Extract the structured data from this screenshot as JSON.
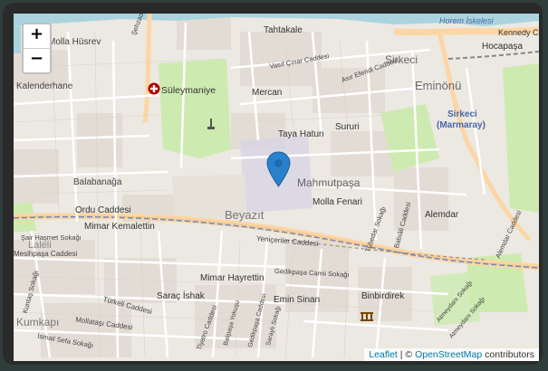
{
  "map": {
    "zoom_in_label": "+",
    "zoom_out_label": "−",
    "attribution": {
      "leaflet": "Leaflet",
      "separator": " | © ",
      "osm": "OpenStreetMap",
      "contributors": " contributors"
    },
    "place_labels": {
      "horem_iskelesi": "Horem İskelesi",
      "tahtakale": "Tahtakale",
      "kennedy": "Kennedy C",
      "molla_husrev": "Molla Hüsrev",
      "sehzade": "Şehzadebaşı Caddesi",
      "vasif_cinar": "Vasıf Çınar Caddesi",
      "asir_efendi": "Asır Efendi Caddesi",
      "sirkeci": "Sirkeci",
      "hocapasa": "Hocapaşa",
      "kalenderhane": "Kalenderhane",
      "suleymaniye": "Süleymaniye",
      "mercan": "Mercan",
      "eminonu": "Eminönü",
      "sirkeci_marmaray_1": "Sirkeci",
      "sirkeci_marmaray_2": "(Marmaray)",
      "sururi": "Sururi",
      "taya_hatun": "Taya Hatun",
      "balabanaga": "Balabanağa",
      "mahmutpasa": "Mahmutpaşa",
      "molla_fenari": "Molla Fenari",
      "ordu_caddesi": "Ordu Caddesi",
      "beyazit": "Beyazıt",
      "alemdar": "Alemdar",
      "mimar_kemalettin": "Mimar Kemalettin",
      "tubedar": "Tübedar Sokağı",
      "babiali": "Babıâli Caddesi",
      "alemdar_caddesi": "Alemdar Caddesi",
      "sair_hasmet": "Şair Haşmet Sokağı",
      "laleli": "Laleli",
      "mesihpasa": "Mesihpaşa Caddesi",
      "yeniceriler": "Yeniçeriler Caddesi",
      "mimar_hayrettin": "Mimar Hayrettin",
      "gedikpasa_camii": "Gedikpaşa Camii Sokağı",
      "kuntas": "Kuntaş Sokağı",
      "sarac_ishak": "Saraç İshak",
      "emin_sinan": "Emin Sinan",
      "binbirdirek": "Binbirdirek",
      "turkeli": "Türkeli Caddesi",
      "tiyatro": "Tiyatro Caddesi",
      "kumkapi": "Kumkapı",
      "mollatasi": "Mollataşı Caddesi",
      "ismail_sefa": "İsmail Sefa Sokağı",
      "atmeydani_1": "Atmeydanı Sokağı",
      "atmeydani_2": "Atmeydanı Sokağı",
      "gedikpasa_cad": "Gedikpaşa Caddesi",
      "balipasa": "Balipaşa Yokuşu",
      "saraylisi": "Saraylı Sokağı"
    }
  },
  "colors": {
    "land": "#f2efe9",
    "water": "#aad3df",
    "park": "#cdebb0",
    "road_major": "#fcd6a4",
    "road_minor": "#ffffff",
    "building": "#d9d0c9",
    "pin": "#2a81cb",
    "tram": "#6a8ac8",
    "label_blue": "#4a67a8"
  },
  "icons": {
    "pin": "map-marker-icon",
    "hospital": "hospital-icon",
    "archaeological": "archaeological-site-icon"
  }
}
